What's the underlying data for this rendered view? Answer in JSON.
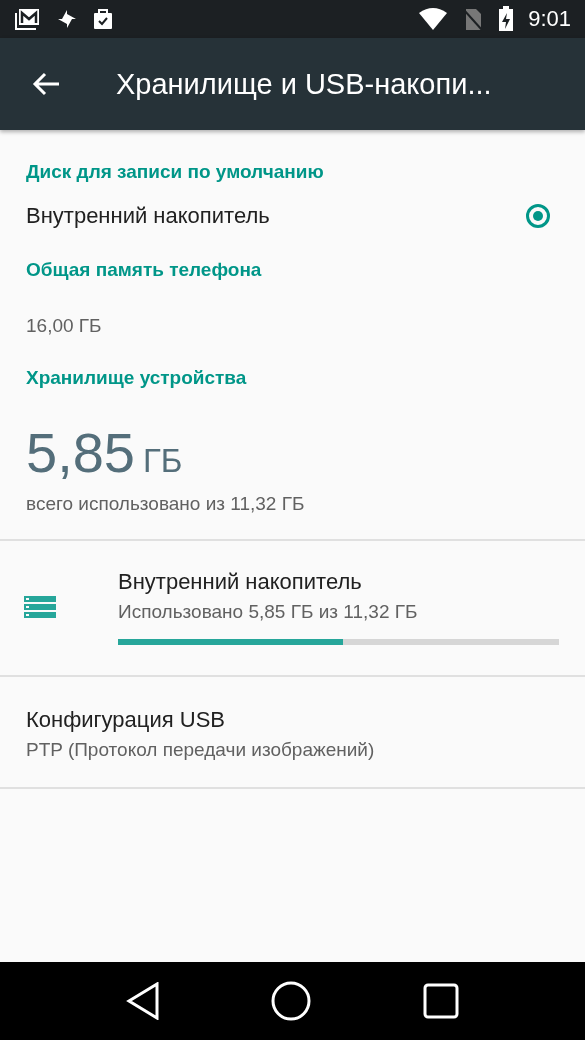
{
  "status_bar": {
    "time": "9:01"
  },
  "toolbar": {
    "title": "Хранилище и USB-накопи..."
  },
  "default_disk": {
    "header": "Диск для записи по умолчанию",
    "option": {
      "label": "Внутренний накопитель",
      "selected": true
    }
  },
  "total_memory": {
    "header": "Общая память телефона",
    "value": "16,00 ГБ"
  },
  "device_storage": {
    "header": "Хранилище устройства",
    "used": "5,85",
    "unit": "ГБ",
    "summary": "всего использовано из 11,32 ГБ"
  },
  "volumes": [
    {
      "title": "Внутренний накопитель",
      "subtitle": "Использовано 5,85 ГБ из 11,32 ГБ",
      "level": 0.51
    }
  ],
  "usb": {
    "title": "Конфигурация USB",
    "subtitle": "PTP (Протокол передачи изображений)"
  }
}
